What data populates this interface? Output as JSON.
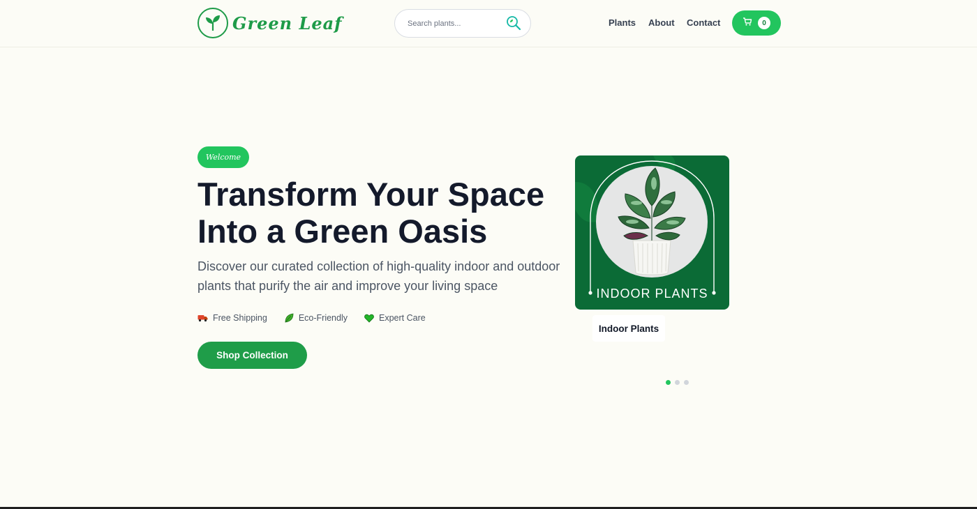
{
  "header": {
    "brand": "Green Leaf",
    "search_placeholder": "Search plants...",
    "nav": [
      "Plants",
      "About",
      "Contact"
    ],
    "cart_count": "0"
  },
  "hero": {
    "badge": "Welcome",
    "title_line1": "Transform Your Space",
    "title_line2": "Into a Green Oasis",
    "subtitle_line1": "Discover our curated collection of high-quality indoor and outdoor",
    "subtitle_line2": "plants that purify the air and improve your living space",
    "features": [
      {
        "label": "Free Shipping",
        "icon": "truck-icon"
      },
      {
        "label": "Eco-Friendly",
        "icon": "leaf-icon"
      },
      {
        "label": "Expert Care",
        "icon": "heart-icon"
      }
    ],
    "cta": "Shop Collection"
  },
  "carousel": {
    "image_caption": "INDOOR PLANTS",
    "card_title": "Indoor Plants",
    "slide_count": 3,
    "active_slide": 1
  },
  "colors": {
    "accent": "#22c55e",
    "brand": "#1e9b48",
    "card_bg": "#0b6b36",
    "page_bg": "#fcfcf6"
  }
}
